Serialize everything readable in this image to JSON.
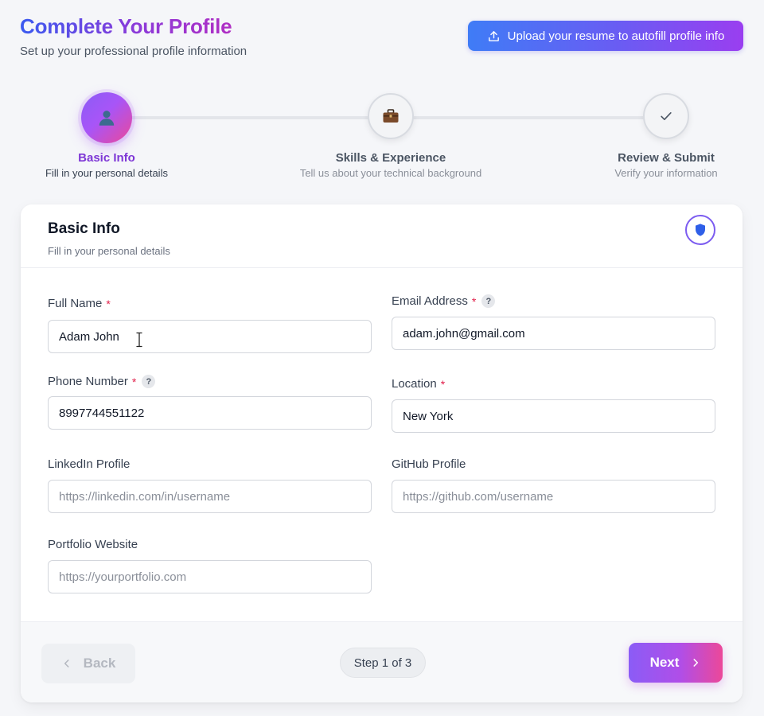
{
  "header": {
    "title": "Complete Your Profile",
    "subtitle": "Set up your professional profile information",
    "upload_label": "Upload your resume to autofill profile info",
    "upload_icon": "upload-icon"
  },
  "stepper": {
    "steps": [
      {
        "title": "Basic Info",
        "description": "Fill in your personal details",
        "icon": "user-icon",
        "state": "active"
      },
      {
        "title": "Skills & Experience",
        "description": "Tell us about your technical background",
        "icon": "briefcase-icon",
        "state": "upcoming"
      },
      {
        "title": "Review & Submit",
        "description": "Verify your information",
        "icon": "check-icon",
        "state": "upcoming"
      }
    ]
  },
  "card": {
    "title": "Basic Info",
    "subtitle": "Fill in your personal details",
    "badge_icon": "shield-icon"
  },
  "fields": {
    "full_name": {
      "label": "Full Name",
      "required_mark": "*",
      "value": "Adam John",
      "placeholder": ""
    },
    "email": {
      "label": "Email Address",
      "required_mark": "*",
      "help": "?",
      "value": "adam.john@gmail.com",
      "placeholder": ""
    },
    "phone": {
      "label": "Phone Number",
      "required_mark": "*",
      "help": "?",
      "value": "8997744551122",
      "placeholder": ""
    },
    "location": {
      "label": "Location",
      "required_mark": "*",
      "value": "New York",
      "placeholder": ""
    },
    "linkedin": {
      "label": "LinkedIn Profile",
      "value": "",
      "placeholder": "https://linkedin.com/in/username"
    },
    "github": {
      "label": "GitHub Profile",
      "value": "",
      "placeholder": "https://github.com/username"
    },
    "portfolio": {
      "label": "Portfolio Website",
      "value": "",
      "placeholder": "https://yourportfolio.com"
    }
  },
  "footer": {
    "back_label": "Back",
    "step_indicator": "Step 1 of 3",
    "next_label": "Next"
  },
  "colors": {
    "accent_start": "#8b5cf6",
    "accent_end": "#ec4899",
    "active_step_text": "#7e36d6",
    "required": "#e11d48"
  }
}
